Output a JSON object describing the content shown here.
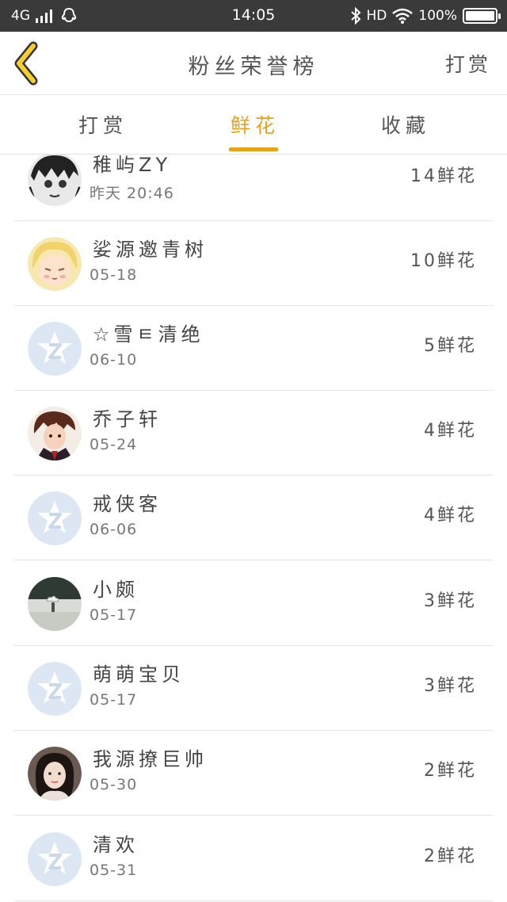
{
  "status_bar": {
    "network": "4G",
    "time": "14:05",
    "hd": "HD",
    "battery": "100%"
  },
  "header": {
    "title": "粉丝荣誉榜",
    "action_label": "打赏"
  },
  "tabs": [
    {
      "label": "打赏",
      "active": false
    },
    {
      "label": "鲜花",
      "active": true
    },
    {
      "label": "收藏",
      "active": false
    }
  ],
  "list": [
    {
      "name": "稚屿ZY",
      "date": "昨天 20:46",
      "count": "14鲜花",
      "avatar": "manga-avatar"
    },
    {
      "name": "娑源邀青树",
      "date": "05-18",
      "count": "10鲜花",
      "avatar": "anime-girl-avatar"
    },
    {
      "name": "☆雪ㅌ清绝",
      "date": "06-10",
      "count": "5鲜花",
      "avatar": "default-qzone-avatar"
    },
    {
      "name": "乔子轩",
      "date": "05-24",
      "count": "4鲜花",
      "avatar": "anime-boy-avatar"
    },
    {
      "name": "戒侠客",
      "date": "06-06",
      "count": "4鲜花",
      "avatar": "default-qzone-avatar"
    },
    {
      "name": "小颇",
      "date": "05-17",
      "count": "3鲜花",
      "avatar": "scenery-avatar"
    },
    {
      "name": "萌萌宝贝",
      "date": "05-17",
      "count": "3鲜花",
      "avatar": "default-qzone-avatar"
    },
    {
      "name": "我源撩巨帅",
      "date": "05-30",
      "count": "2鲜花",
      "avatar": "photo-girl-avatar"
    },
    {
      "name": "清欢",
      "date": "05-31",
      "count": "2鲜花",
      "avatar": "default-qzone-avatar"
    }
  ],
  "colors": {
    "accent": "#e9a117",
    "status_bar_bg": "#3a3a3a",
    "divider": "#e4e4e4"
  }
}
